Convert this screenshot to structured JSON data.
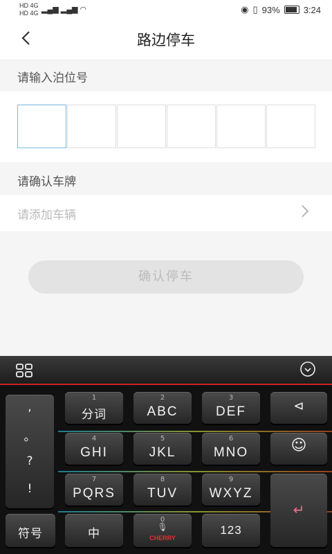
{
  "status_bar": {
    "left_top": "HD 4G",
    "left_bottom": "HD 4G",
    "battery": "93%",
    "time": "3:24"
  },
  "nav": {
    "back_icon": "chevron-left-icon",
    "title": "路边停车"
  },
  "form": {
    "plate_label": "请输入泊位号",
    "plate_boxes": [
      "",
      "",
      "",
      "",
      "",
      ""
    ],
    "vehicle_label": "请确认车牌",
    "vehicle_placeholder": "请添加车辆",
    "confirm_button": "确认停车"
  },
  "keyboard": {
    "punct": [
      ",",
      "。",
      "?",
      "!"
    ],
    "rows": [
      [
        {
          "num": "1",
          "label": "分词"
        },
        {
          "num": "2",
          "label": "ABC"
        },
        {
          "num": "3",
          "label": "DEF"
        }
      ],
      [
        {
          "num": "4",
          "label": "GHI"
        },
        {
          "num": "5",
          "label": "JKL"
        },
        {
          "num": "6",
          "label": "MNO"
        }
      ],
      [
        {
          "num": "7",
          "label": "PQRS"
        },
        {
          "num": "8",
          "label": "TUV"
        },
        {
          "num": "9",
          "label": "WXYZ"
        }
      ]
    ],
    "symbol": "符号",
    "chinese": "中",
    "zero_num": "0",
    "brand": "CHERRY",
    "num_key": "123",
    "accent_color": "#cc2222"
  }
}
